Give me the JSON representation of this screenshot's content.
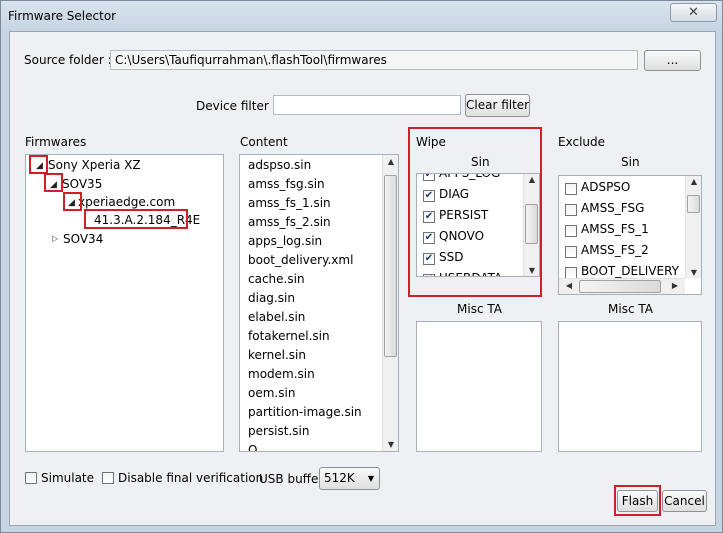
{
  "window": {
    "title": "Firmware Selector",
    "close_glyph": "✕"
  },
  "source": {
    "label": "Source folder :",
    "path": "C:\\Users\\Taufiqurrahman\\.flashTool\\firmwares",
    "browse_label": "..."
  },
  "filter": {
    "label": "Device filter :",
    "value": "",
    "clear_label": "Clear filter"
  },
  "firmwares": {
    "header": "Firmwares",
    "tree": [
      {
        "label": "Sony Xperia XZ",
        "expanded": true
      },
      {
        "label": "SOV35",
        "expanded": true
      },
      {
        "label": "xperiaedge.com",
        "expanded": true
      },
      {
        "label": "41.3.A.2.184_R4E",
        "selected": true
      },
      {
        "label": "SOV34",
        "expanded": false
      }
    ]
  },
  "content": {
    "header": "Content",
    "items": [
      "adspso.sin",
      "amss_fsg.sin",
      "amss_fs_1.sin",
      "amss_fs_2.sin",
      "apps_log.sin",
      "boot_delivery.xml",
      "cache.sin",
      "diag.sin",
      "elabel.sin",
      "fotakernel.sin",
      "kernel.sin",
      "modem.sin",
      "oem.sin",
      "partition-image.sin",
      "persist.sin",
      "Q..."
    ]
  },
  "wipe": {
    "header": "Wipe",
    "sin_label": "Sin",
    "items": [
      {
        "label": "APPS_LOG",
        "checked": true
      },
      {
        "label": "DIAG",
        "checked": true
      },
      {
        "label": "PERSIST",
        "checked": true
      },
      {
        "label": "QNOVO",
        "checked": true
      },
      {
        "label": "SSD",
        "checked": true
      },
      {
        "label": "USERDATA",
        "checked": true
      }
    ],
    "misc_label": "Misc TA"
  },
  "exclude": {
    "header": "Exclude",
    "sin_label": "Sin",
    "items": [
      {
        "label": "ADSPSO",
        "checked": false
      },
      {
        "label": "AMSS_FSG",
        "checked": false
      },
      {
        "label": "AMSS_FS_1",
        "checked": false
      },
      {
        "label": "AMSS_FS_2",
        "checked": false
      },
      {
        "label": "BOOT_DELIVERY",
        "checked": false
      }
    ],
    "misc_label": "Misc TA"
  },
  "options": {
    "simulate_label": "Simulate",
    "simulate_checked": false,
    "disable_verification_label": "Disable final verification",
    "disable_verification_checked": false,
    "usb_buffer_label": "USB buffer",
    "usb_buffer_value": "512K"
  },
  "actions": {
    "flash_label": "Flash",
    "cancel_label": "Cancel"
  },
  "colors": {
    "highlight_red": "#d11f2a",
    "window_blue": "#c7d4e2"
  },
  "icons": {
    "expanded": "expanded-triangle-icon",
    "collapsed": "collapsed-triangle-icon",
    "check": "checkmark-icon"
  }
}
